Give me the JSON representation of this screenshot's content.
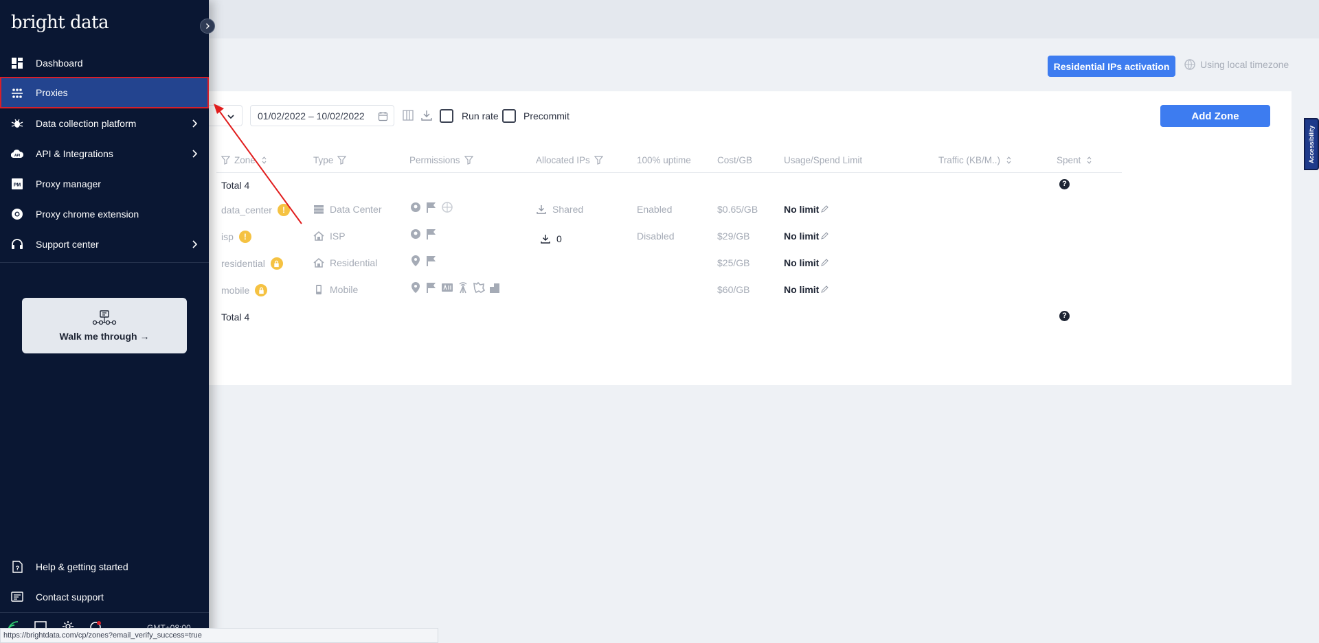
{
  "header": {
    "activation_button": "Residential IPs activation",
    "timezone_label": "Using local timezone"
  },
  "toolbar": {
    "date_range": "01/02/2022 – 10/02/2022",
    "run_rate": "Run rate",
    "precommit": "Precommit",
    "add_zone": "Add Zone"
  },
  "table": {
    "columns": {
      "zone": "Zone",
      "type": "Type",
      "permissions": "Permissions",
      "allocated_ips": "Allocated IPs",
      "uptime": "100% uptime",
      "cost": "Cost/GB",
      "usage": "Usage/Spend Limit",
      "traffic": "Traffic (KB/M..)",
      "spent": "Spent"
    },
    "total_label": "Total 4",
    "rows": [
      {
        "zone": "data_center",
        "type": "Data Center",
        "allocated": "Shared",
        "uptime": "Enabled",
        "cost": "$0.65/GB",
        "limit": "No limit"
      },
      {
        "zone": "isp",
        "type": "ISP",
        "allocated": "0",
        "uptime": "Disabled",
        "cost": "$29/GB",
        "limit": "No limit"
      },
      {
        "zone": "residential",
        "type": "Residential",
        "allocated": "",
        "uptime": "",
        "cost": "$25/GB",
        "limit": "No limit"
      },
      {
        "zone": "mobile",
        "type": "Mobile",
        "allocated": "",
        "uptime": "",
        "cost": "$60/GB",
        "limit": "No limit"
      }
    ],
    "badge_symbol": "!",
    "help_symbol": "?"
  },
  "sidebar": {
    "logo_light": "bright",
    "logo_bold": " data",
    "items": [
      {
        "label": "Dashboard"
      },
      {
        "label": "Proxies"
      },
      {
        "label": "Data collection platform"
      },
      {
        "label": "API & Integrations"
      },
      {
        "label": "Proxy manager"
      },
      {
        "label": "Proxy chrome extension"
      },
      {
        "label": "Support center"
      }
    ],
    "walk_me": "Walk me through →",
    "help": "Help & getting started",
    "contact": "Contact support",
    "gmt": "GMT+08:00"
  },
  "accessibility_tab": "Accessibility",
  "status_url": "https://brightdata.com/cp/zones?email_verify_success=true",
  "colors": {
    "sidebar_bg": "#0a1733",
    "accent": "#3d7cf0",
    "active_item": "#23448f",
    "highlight_border": "#d71f2a",
    "warning": "#f5c242"
  }
}
